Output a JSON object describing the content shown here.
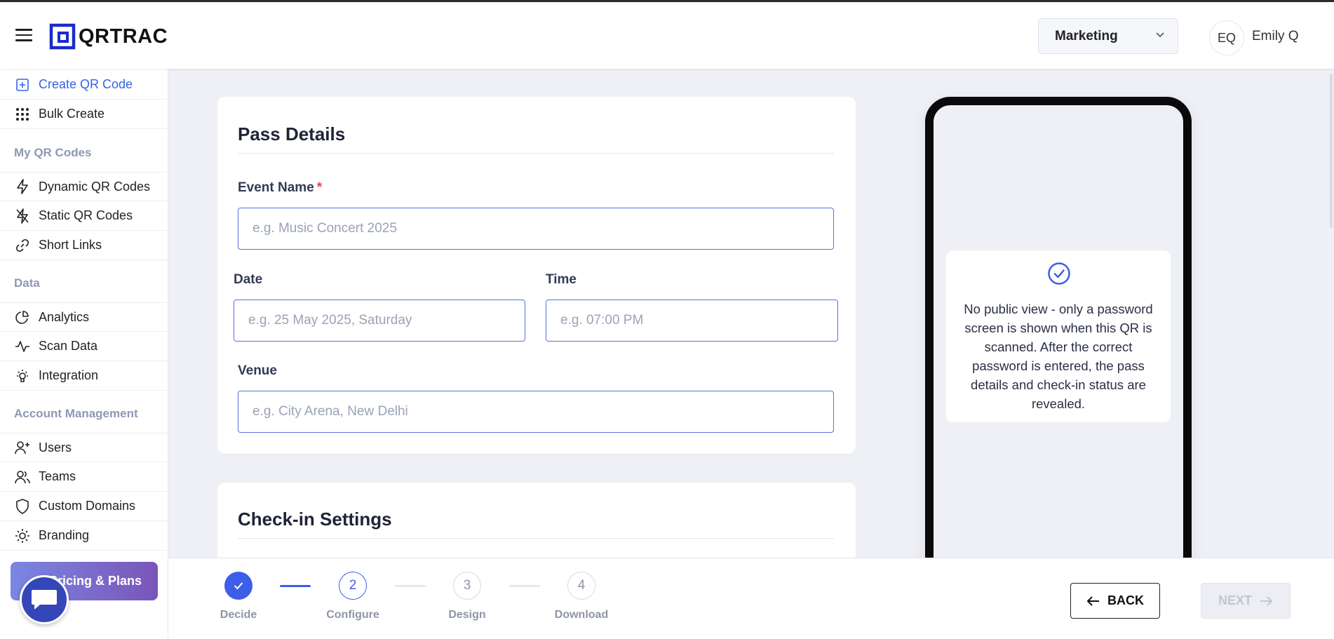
{
  "header": {
    "brand": "QRTRAC",
    "workspace": "Marketing",
    "avatar_initials": "EQ",
    "user_name": "Emily Q"
  },
  "sidebar": {
    "create_qr": "Create QR Code",
    "bulk_create": "Bulk Create",
    "section_my_qr": "My QR Codes",
    "dynamic_qr": "Dynamic QR Codes",
    "static_qr": "Static QR Codes",
    "short_links": "Short Links",
    "section_data": "Data",
    "analytics": "Analytics",
    "scan_data": "Scan Data",
    "integration": "Integration",
    "section_account": "Account Management",
    "users": "Users",
    "teams": "Teams",
    "custom_domains": "Custom Domains",
    "branding": "Branding",
    "pricing": "Pricing & Plans"
  },
  "pass_details": {
    "title": "Pass Details",
    "event_name_label": "Event Name",
    "required_mark": "*",
    "event_name_placeholder": "e.g. Music Concert 2025",
    "date_label": "Date",
    "date_placeholder": "e.g. 25 May 2025, Saturday",
    "time_label": "Time",
    "time_placeholder": "e.g. 07:00 PM",
    "venue_label": "Venue",
    "venue_placeholder": "e.g. City Arena, New Delhi"
  },
  "checkin": {
    "title": "Check-in Settings"
  },
  "preview": {
    "message": "No public view - only a password screen is shown when this QR is scanned. After the correct password is entered, the pass details and check-in status are revealed."
  },
  "stepper": {
    "steps": [
      {
        "number": "1",
        "label": "Decide",
        "state": "done"
      },
      {
        "number": "2",
        "label": "Configure",
        "state": "current"
      },
      {
        "number": "3",
        "label": "Design",
        "state": "todo"
      },
      {
        "number": "4",
        "label": "Download",
        "state": "todo"
      }
    ]
  },
  "actions": {
    "back": "BACK",
    "next": "NEXT"
  },
  "colors": {
    "accent": "#3c5ee8",
    "sidebar_active": "#3563e9",
    "required": "#e5484d"
  }
}
